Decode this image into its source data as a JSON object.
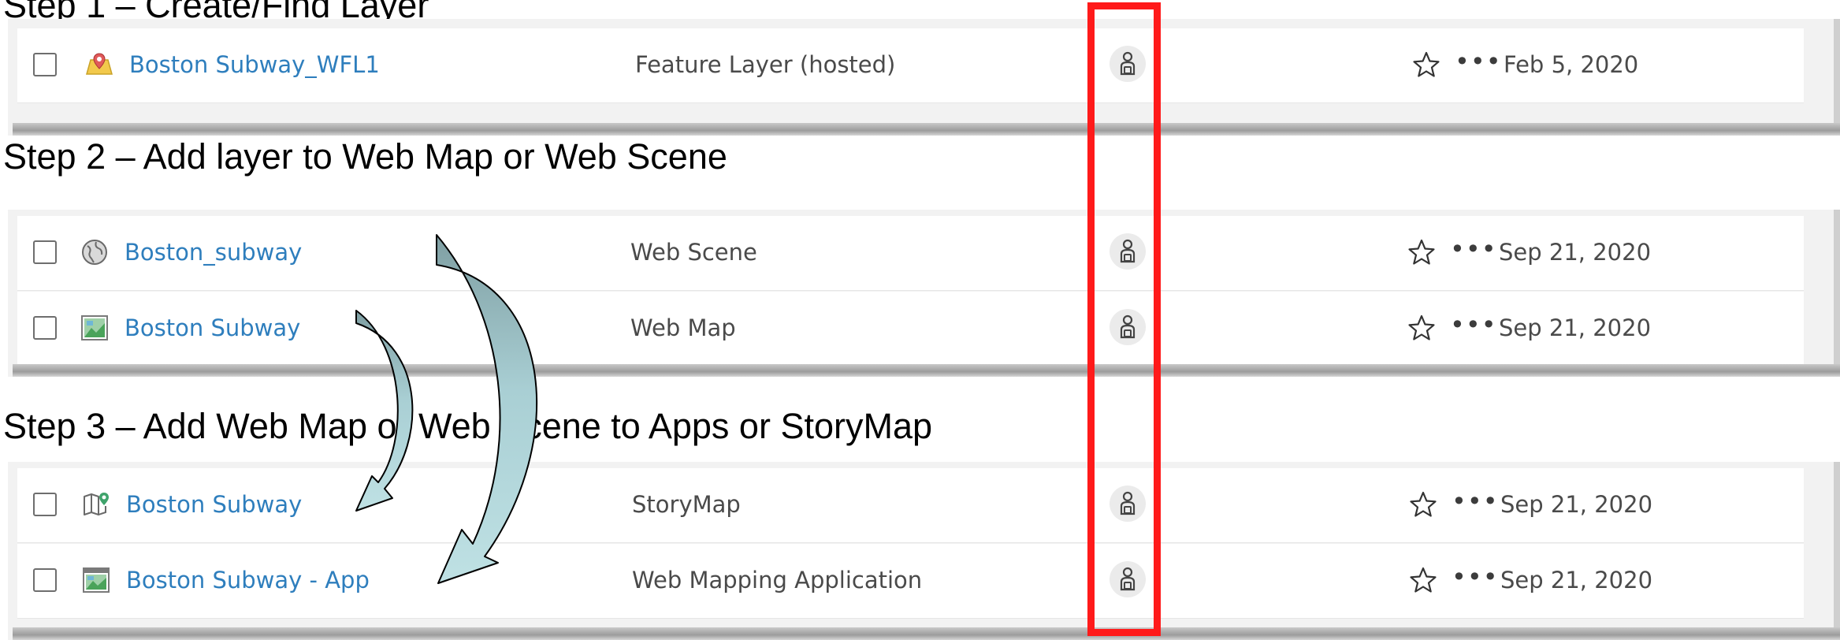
{
  "steps": [
    {
      "heading": "Step 1 – Create/Find Layer"
    },
    {
      "heading": "Step 2 – Add layer to Web Map or Web Scene"
    },
    {
      "heading": "Step 3 – Add Web Map or Web Scene to Apps or StoryMap"
    }
  ],
  "panels": [
    {
      "rows": [
        {
          "title": "Boston Subway_WFL1",
          "type": "Feature Layer (hosted)",
          "date": "Feb 5, 2020",
          "icon": "feature-layer-icon"
        }
      ]
    },
    {
      "rows": [
        {
          "title": "Boston_subway",
          "type": "Web Scene",
          "date": "Sep 21, 2020",
          "icon": "web-scene-globe-icon"
        },
        {
          "title": "Boston Subway",
          "type": "Web Map",
          "date": "Sep 21, 2020",
          "icon": "web-map-icon"
        }
      ]
    },
    {
      "rows": [
        {
          "title": "Boston Subway",
          "type": "StoryMap",
          "date": "Sep 21, 2020",
          "icon": "storymap-icon"
        },
        {
          "title": "Boston Subway - App",
          "type": "Web Mapping Application",
          "date": "Sep 21, 2020",
          "icon": "web-app-icon"
        }
      ]
    }
  ],
  "row_actions": {
    "more": "•••"
  },
  "colors": {
    "link": "#2e7ebd",
    "highlight": "#ff1a1a",
    "arrow_fill": "#a9cfd4",
    "arrow_fill_dark": "#7f9fa3"
  }
}
